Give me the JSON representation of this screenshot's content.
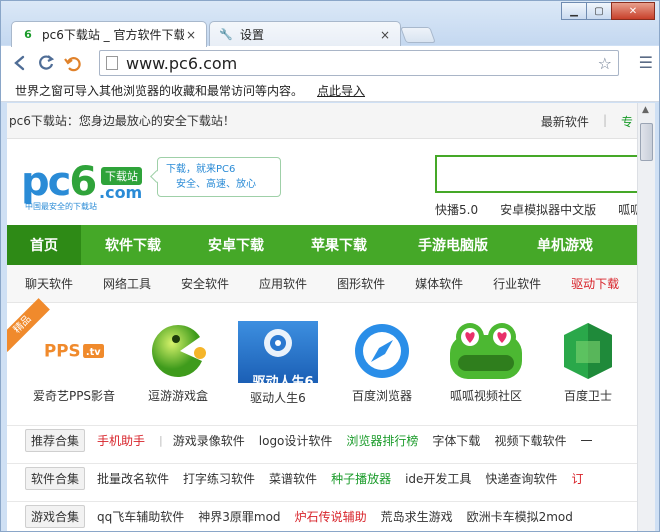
{
  "browser": {
    "tabs": [
      {
        "title": "pc6下载站 _ 官方软件下载",
        "favicon": "6",
        "active": true
      },
      {
        "title": "设置",
        "favicon": "🔧",
        "active": false
      }
    ],
    "close_glyph": "×",
    "window_controls": {
      "minimize": "▁",
      "maximize": "▢",
      "close": "✕"
    },
    "url": "www.pc6.com",
    "bookmark_prompt": "世界之窗可导入其他浏览器的收藏和最常访问等内容。",
    "bookmark_import": "点此导入"
  },
  "site": {
    "top_tagline": "pc6下载站：您身边最放心的安全下载站！",
    "top_links": [
      "最新软件",
      "|",
      "专"
    ],
    "logo": {
      "text_pc": "pc",
      "text_6": "6",
      "badge": "下载站",
      "dotcom": ".com",
      "sub": "中国最安全的下载站"
    },
    "slogan_line1": "下载，就来PC6",
    "slogan_line2": "安全、高速、放心",
    "hot_words": [
      "快播5.0",
      "安卓模拟器中文版",
      "呱呱"
    ],
    "main_nav": [
      "首页",
      "软件下载",
      "安卓下载",
      "苹果下载",
      "手游电脑版",
      "单机游戏"
    ],
    "sub_nav": [
      "聊天软件",
      "网络工具",
      "安全软件",
      "应用软件",
      "图形软件",
      "媒体软件",
      "行业软件",
      "驱动下载"
    ],
    "ribbon": "精品",
    "apps": [
      {
        "name": "爱奇艺PPS影音",
        "icon": "pps-logo-icon"
      },
      {
        "name": "逗游游戏盒",
        "icon": "green-pacman-icon"
      },
      {
        "name": "驱动人生6",
        "icon": "driver-life-icon",
        "label": "驱动人生6"
      },
      {
        "name": "百度浏览器",
        "icon": "baidu-browser-icon"
      },
      {
        "name": "呱呱视频社区",
        "icon": "frog-icon"
      },
      {
        "name": "百度卫士",
        "icon": "baidu-guard-icon"
      }
    ],
    "tag_rows": [
      {
        "category": "推荐合集",
        "tags": [
          {
            "text": "手机助手",
            "color": "red"
          },
          {
            "text": "|",
            "color": "sep"
          },
          {
            "text": "游戏录像软件",
            "color": "normal"
          },
          {
            "text": "logo设计软件",
            "color": "normal"
          },
          {
            "text": "浏览器排行榜",
            "color": "green"
          },
          {
            "text": "字体下载",
            "color": "normal"
          },
          {
            "text": "视频下载软件",
            "color": "normal"
          },
          {
            "text": "一",
            "color": "normal"
          }
        ]
      },
      {
        "category": "软件合集",
        "tags": [
          {
            "text": "批量改名软件",
            "color": "normal"
          },
          {
            "text": "打字练习软件",
            "color": "normal"
          },
          {
            "text": "菜谱软件",
            "color": "normal"
          },
          {
            "text": "种子播放器",
            "color": "green"
          },
          {
            "text": "ide开发工具",
            "color": "normal"
          },
          {
            "text": "快递查询软件",
            "color": "normal"
          },
          {
            "text": "订",
            "color": "red"
          }
        ]
      },
      {
        "category": "游戏合集",
        "tags": [
          {
            "text": "qq飞车辅助软件",
            "color": "normal"
          },
          {
            "text": "神界3原罪mod",
            "color": "normal"
          },
          {
            "text": "炉石传说辅助",
            "color": "red"
          },
          {
            "text": "荒岛求生游戏",
            "color": "normal"
          },
          {
            "text": "欧洲卡车模拟2mod",
            "color": "normal"
          }
        ]
      }
    ]
  },
  "colors": {
    "site_green": "#45a828",
    "nav_active": "#2e8a16",
    "link_red": "#d8242b",
    "logo_blue": "#2a8bd6"
  }
}
